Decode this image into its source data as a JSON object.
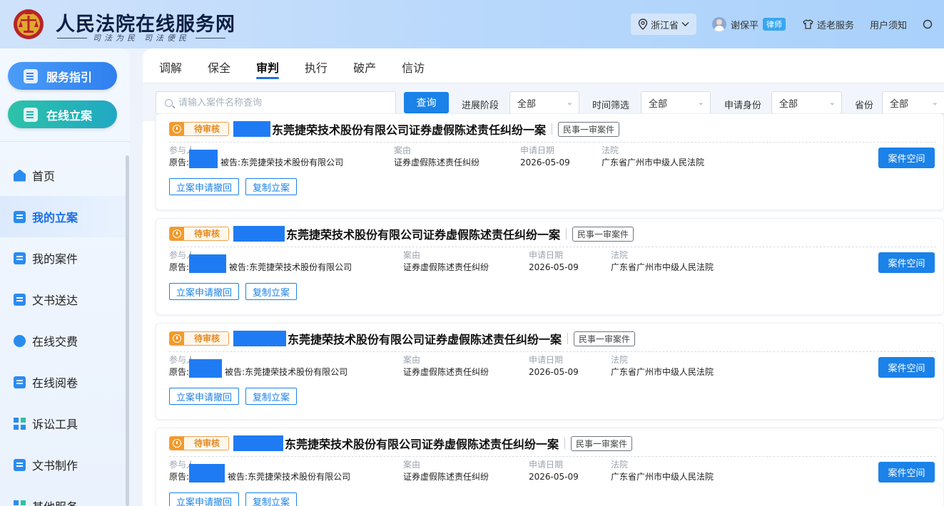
{
  "header": {
    "title": "人民法院在线服务网",
    "slogan_left": "司法为民",
    "slogan_right": "司法便民",
    "region": "浙江省",
    "user_name": "谢保平",
    "user_role": "律师",
    "elderly_service": "适老服务",
    "user_notice": "用户须知"
  },
  "sidebar": {
    "guide_button": "服务指引",
    "file_button": "在线立案",
    "items": [
      {
        "label": "首页",
        "icon": "home-icon"
      },
      {
        "label": "我的立案",
        "icon": "edit-icon",
        "active": true
      },
      {
        "label": "我的案件",
        "icon": "clipboard-icon"
      },
      {
        "label": "文书送达",
        "icon": "monitor-icon"
      },
      {
        "label": "在线交费",
        "icon": "payment-icon"
      },
      {
        "label": "在线阅卷",
        "icon": "clipboard-icon"
      },
      {
        "label": "诉讼工具",
        "icon": "grid-icon"
      },
      {
        "label": "文书制作",
        "icon": "document-icon"
      },
      {
        "label": "其他服务",
        "icon": "grid-icon"
      }
    ]
  },
  "tabs": [
    "调解",
    "保全",
    "审判",
    "执行",
    "破产",
    "信访"
  ],
  "active_tab": "审判",
  "filters": {
    "search_placeholder": "请输入案件名称查询",
    "query_button": "查询",
    "stage_label": "进展阶段",
    "stage_value": "全部",
    "time_label": "时间筛选",
    "time_value": "全部",
    "identity_label": "申请身份",
    "identity_value": "全部",
    "province_label": "省份",
    "province_value": "全部"
  },
  "card_labels": {
    "participants": "参与人",
    "plaintiff": "原告:",
    "defendant_prefix": "被告:",
    "cause": "案由",
    "apply_date": "申请日期",
    "court": "法院",
    "space_button": "案件空间",
    "withdraw_button": "立案申请撤回",
    "copy_button": "复制立案"
  },
  "cases": [
    {
      "status": "待审核",
      "title": "东莞捷荣技术股份有限公司证券虚假陈述责任纠纷一案",
      "tag": "民事一审案件",
      "defendant": "东莞捷荣技术股份有限公司",
      "cause": "证券虚假陈述责任纠纷",
      "date": "2026-05-09",
      "court": "广东省广州市中级人民法院"
    },
    {
      "status": "待审核",
      "title": "东莞捷荣技术股份有限公司证券虚假陈述责任纠纷一案",
      "tag": "民事一审案件",
      "defendant": "东莞捷荣技术股份有限公司",
      "cause": "证券虚假陈述责任纠纷",
      "date": "2026-05-09",
      "court": "广东省广州市中级人民法院"
    },
    {
      "status": "待审核",
      "title": "东莞捷荣技术股份有限公司证券虚假陈述责任纠纷一案",
      "tag": "民事一审案件",
      "defendant": "东莞捷荣技术股份有限公司",
      "cause": "证券虚假陈述责任纠纷",
      "date": "2026-05-09",
      "court": "广东省广州市中级人民法院"
    },
    {
      "status": "待审核",
      "title": "东莞捷荣技术股份有限公司证券虚假陈述责任纠纷一案",
      "tag": "民事一审案件",
      "defendant": "东莞捷荣技术股份有限公司",
      "cause": "证券虚假陈述责任纠纷",
      "date": "2026-05-09",
      "court": "广东省广州市中级人民法院"
    }
  ],
  "colors": {
    "primary": "#1a82e8",
    "pending": "#f39a2b",
    "redaction": "#1f7bf3"
  }
}
